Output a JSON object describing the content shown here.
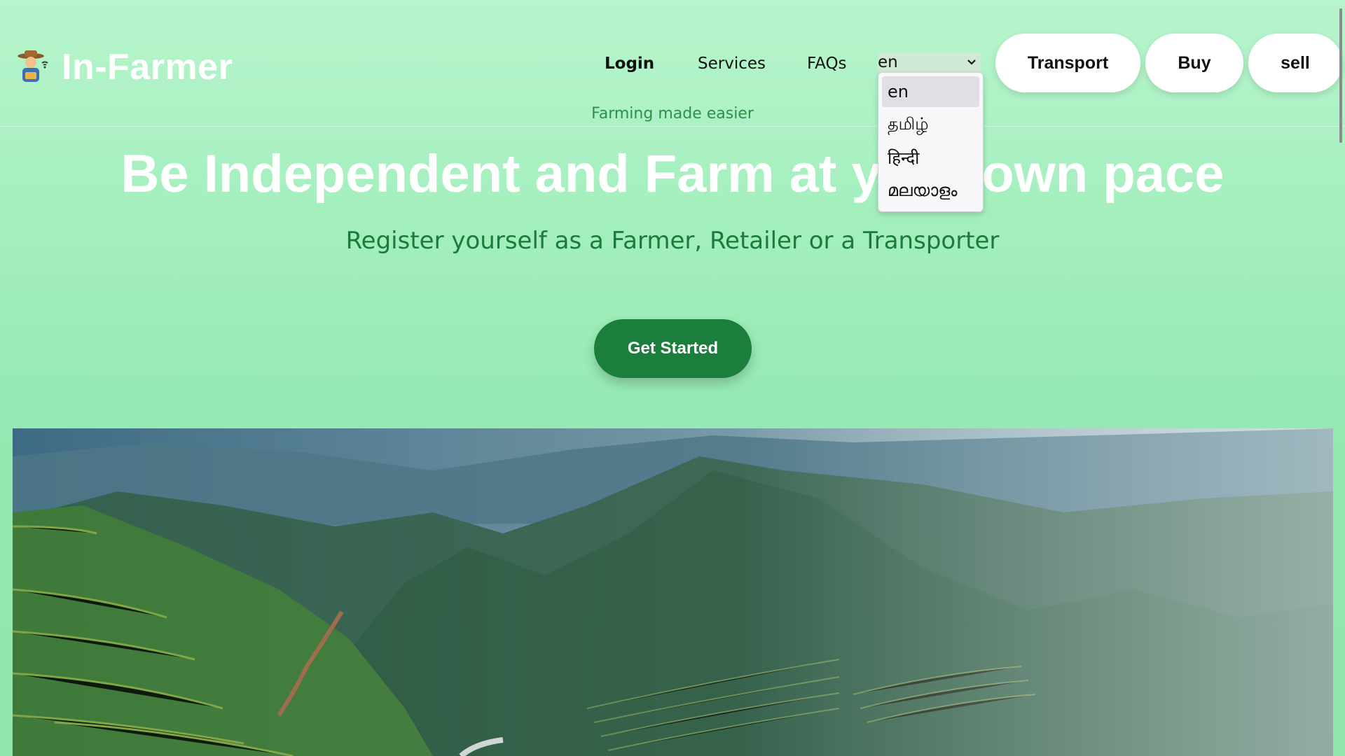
{
  "brand": {
    "name": "In-Farmer",
    "logo_icon": "farmer-icon"
  },
  "nav": {
    "login": "Login",
    "services": "Services",
    "faqs": "FAQs"
  },
  "language": {
    "selected": "en",
    "options": [
      "en",
      "தமிழ்",
      "हिन्दी",
      "മലയാളം"
    ]
  },
  "actions": {
    "transport": "Transport",
    "buy": "Buy",
    "sell": "sell"
  },
  "hero": {
    "tagline": "Farming made easier",
    "title": "Be Independent and Farm at your own pace",
    "subtitle": "Register yourself as a Farmer, Retailer or a Transporter",
    "cta": "Get Started"
  },
  "colors": {
    "accent": "#1b7e3c",
    "background": "#a3eebd",
    "tagline": "#2e8f4a"
  }
}
